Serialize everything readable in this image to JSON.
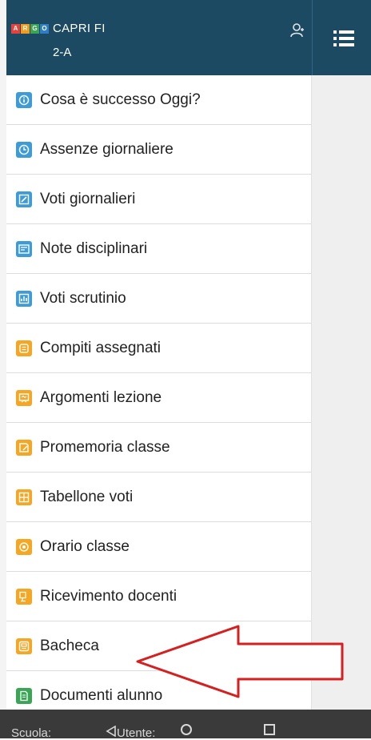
{
  "header": {
    "logo_letters": [
      "A",
      "R",
      "G",
      "O"
    ],
    "logo_colors": [
      "#e8403a",
      "#f29b1d",
      "#3aa655",
      "#2f7cc8"
    ],
    "school": "CAPRI FI",
    "class": "2-A"
  },
  "menu": {
    "items": [
      {
        "label": "Cosa è successo Oggi?",
        "icon": "info-icon",
        "color": "#3d9bd8"
      },
      {
        "label": "Assenze giornaliere",
        "icon": "clock-icon",
        "color": "#3d9bd8"
      },
      {
        "label": "Voti giornalieri",
        "icon": "edit-icon",
        "color": "#3d9bd8"
      },
      {
        "label": "Note disciplinari",
        "icon": "note-icon",
        "color": "#3d9bd8"
      },
      {
        "label": "Voti scrutinio",
        "icon": "chart-icon",
        "color": "#3d9bd8"
      },
      {
        "label": "Compiti assegnati",
        "icon": "book-icon",
        "color": "#f5a623"
      },
      {
        "label": "Argomenti lezione",
        "icon": "board-icon",
        "color": "#f5a623"
      },
      {
        "label": "Promemoria classe",
        "icon": "memo-icon",
        "color": "#f5a623"
      },
      {
        "label": "Tabellone voti",
        "icon": "table-icon",
        "color": "#f5a623"
      },
      {
        "label": "Orario classe",
        "icon": "schedule-icon",
        "color": "#f5a623"
      },
      {
        "label": "Ricevimento docenti",
        "icon": "meeting-icon",
        "color": "#f5a623"
      },
      {
        "label": "Bacheca",
        "icon": "bulletin-icon",
        "color": "#f5a623"
      },
      {
        "label": "Documenti alunno",
        "icon": "document-icon",
        "color": "#3aa655"
      }
    ]
  },
  "bottom_bar": {
    "school_label": "Scuola:",
    "user_label": "Utente:"
  }
}
